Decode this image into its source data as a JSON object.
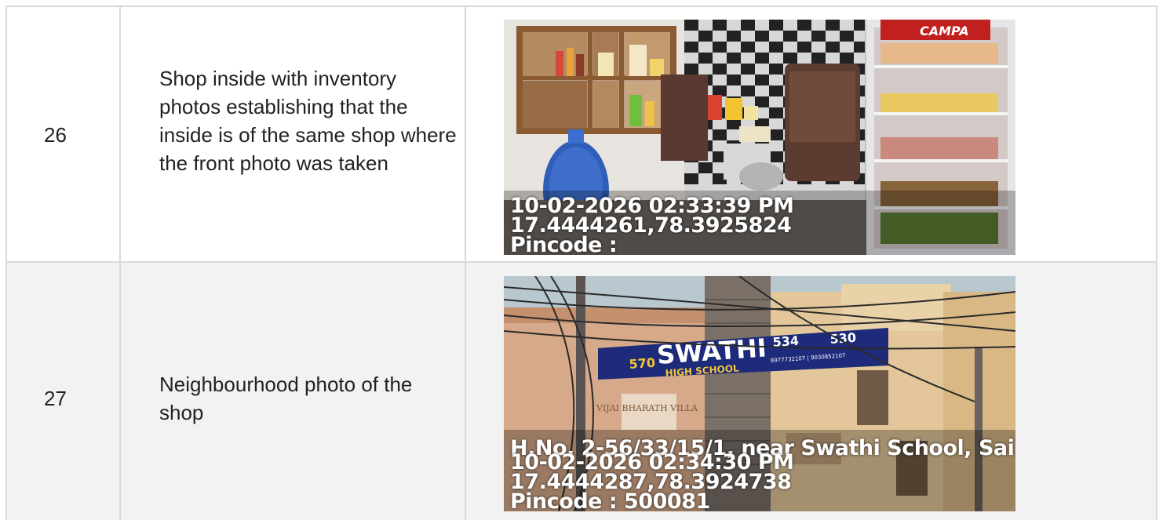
{
  "rows": [
    {
      "number": "26",
      "description": "Shop inside with inventory photos establishing that the inside is of the same shop where the front photo was taken",
      "photo": {
        "brand_text": "CAMPA",
        "stamp_datetime": "10-02-2026 02:33:39 PM",
        "stamp_coords": "17.4444261,78.3925824",
        "stamp_pincode": "Pincode :"
      }
    },
    {
      "number": "27",
      "description": "Neighbourhood photo of the shop",
      "photo": {
        "banner_name": "SWATHI",
        "banner_sub": "HIGH SCHOOL",
        "banner_nums": [
          "570",
          "534",
          "530"
        ],
        "banner_phones": "8977732107 | 9030852107",
        "building_text": "VIJAI BHARATH VILLA",
        "stamp_address": "H.No. 2-56/33/15/1, near Swathi School, Sai",
        "stamp_datetime": "10-02-2026 02:34:30 PM",
        "stamp_coords": "17.4444287,78.3924738",
        "stamp_pincode": "Pincode : 500081"
      }
    }
  ]
}
